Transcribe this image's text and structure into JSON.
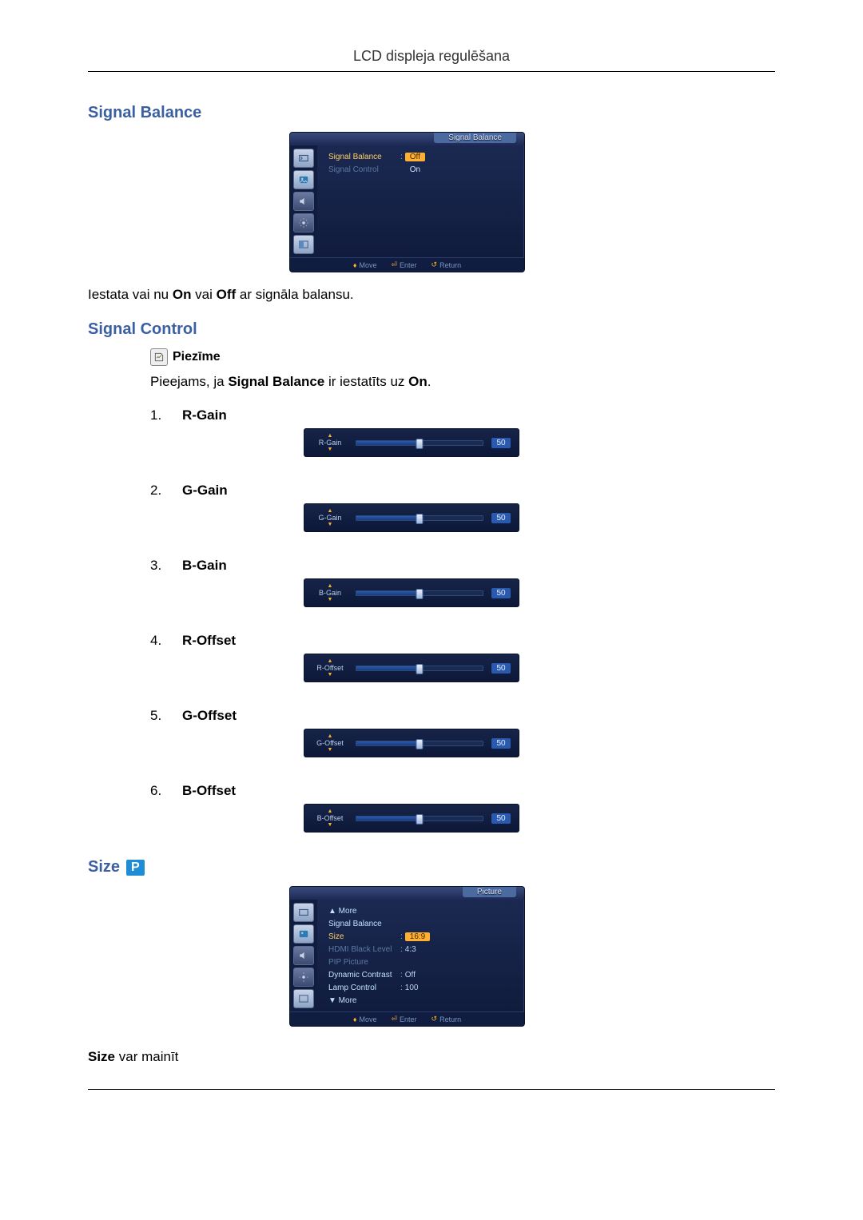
{
  "header": {
    "title": "LCD displeja regulēšana"
  },
  "sections": {
    "signal_balance": {
      "heading": "Signal Balance",
      "desc_pre": "Iestata vai nu ",
      "desc_b1": "On",
      "desc_mid": " vai ",
      "desc_b2": "Off",
      "desc_post": " ar signāla balansu.",
      "osd": {
        "title": "Signal Balance",
        "items": [
          {
            "label": "Signal Balance",
            "active": true
          },
          {
            "label": "Signal Control",
            "active": false
          }
        ],
        "options": {
          "off": "Off",
          "on": "On"
        },
        "footer": {
          "move": "Move",
          "enter": "Enter",
          "return": "Return"
        }
      }
    },
    "signal_control": {
      "heading": "Signal Control",
      "note_label": "Piezīme",
      "desc_pre": "Pieejams, ja ",
      "desc_b1": "Signal Balance",
      "desc_mid": " ir iestatīts uz ",
      "desc_b2": "On",
      "desc_post": ".",
      "items": [
        {
          "num": "1.",
          "label": "R-Gain",
          "slider_label": "R-Gain",
          "value": 50
        },
        {
          "num": "2.",
          "label": "G-Gain",
          "slider_label": "G-Gain",
          "value": 50
        },
        {
          "num": "3.",
          "label": "B-Gain",
          "slider_label": "B-Gain",
          "value": 50
        },
        {
          "num": "4.",
          "label": "R-Offset",
          "slider_label": "R-Offset",
          "value": 50
        },
        {
          "num": "5.",
          "label": "G-Offset",
          "slider_label": "G-Offset",
          "value": 50
        },
        {
          "num": "6.",
          "label": "B-Offset",
          "slider_label": "B-Offset",
          "value": 50
        }
      ]
    },
    "size": {
      "heading": "Size",
      "badge": "P",
      "foot_b": "Size",
      "foot_rest": " var mainīt",
      "osd": {
        "title": "Picture",
        "more_up": "▲ More",
        "more_down": "▼ More",
        "rows": [
          {
            "label": "Signal Balance",
            "val": "",
            "active": false,
            "dim": false
          },
          {
            "label": "Size",
            "val": "16:9",
            "active": true,
            "dim": false,
            "hl": true
          },
          {
            "label": "HDMI Black Level",
            "val": "4:3",
            "active": false,
            "dim": true
          },
          {
            "label": "PIP Picture",
            "val": "",
            "active": false,
            "dim": true
          },
          {
            "label": "Dynamic Contrast",
            "val": "Off",
            "active": false,
            "dim": false
          },
          {
            "label": "Lamp Control",
            "val": "100",
            "active": false,
            "dim": false
          }
        ],
        "footer": {
          "move": "Move",
          "enter": "Enter",
          "return": "Return"
        }
      }
    }
  }
}
